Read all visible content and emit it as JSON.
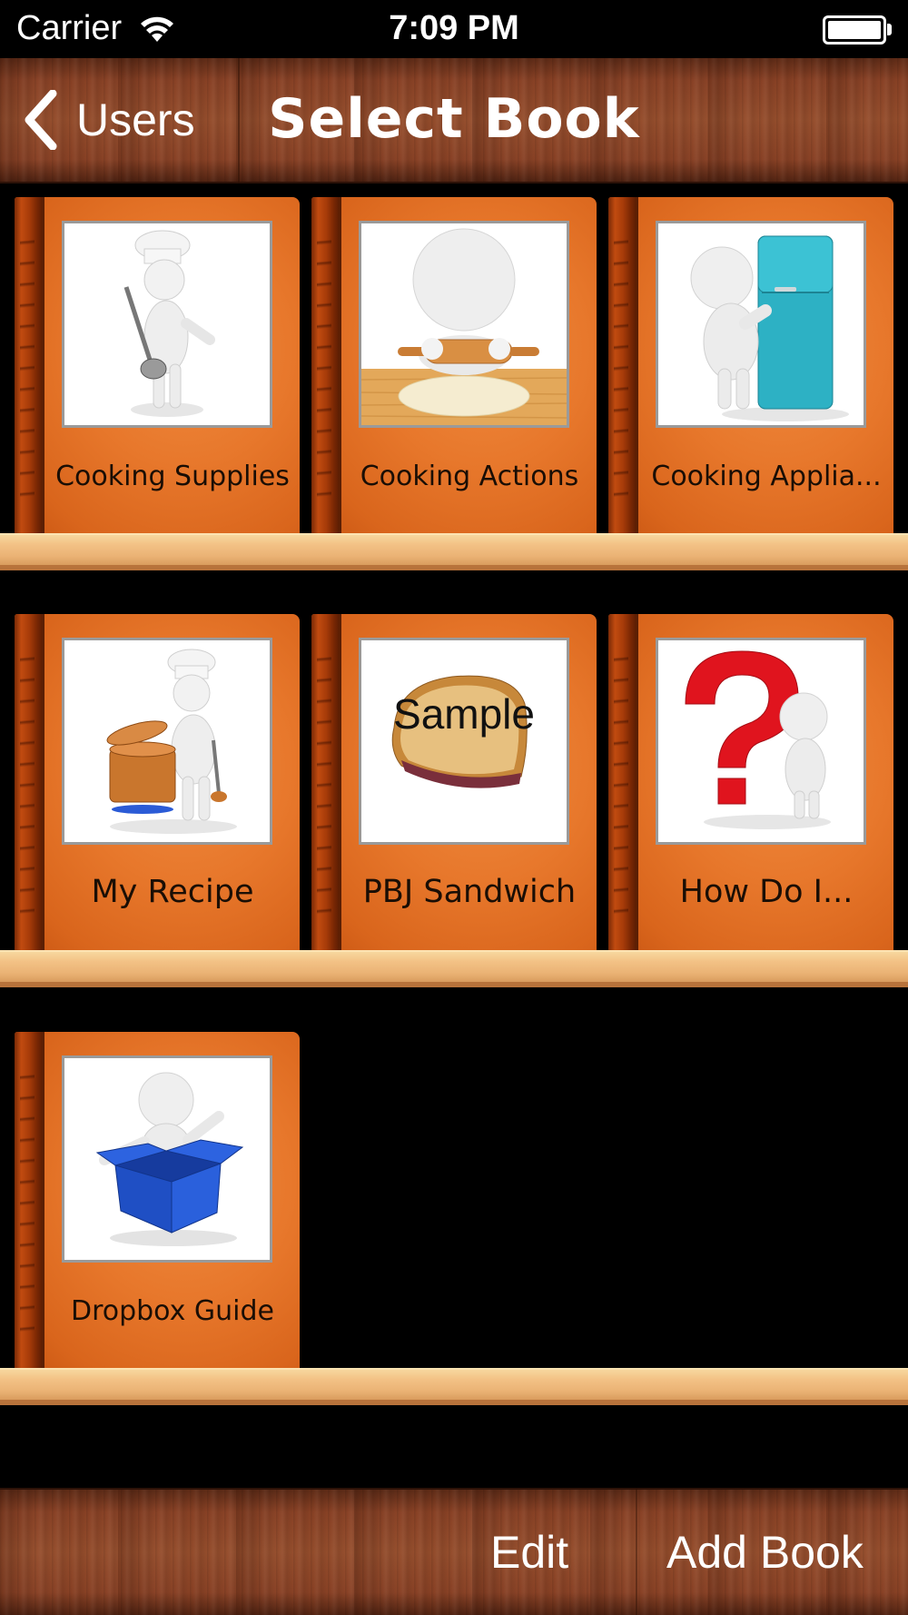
{
  "status_bar": {
    "carrier": "Carrier",
    "time": "7:09 PM",
    "wifi_icon": "wifi-icon",
    "battery_icon": "battery-icon"
  },
  "nav": {
    "back_label": "Users",
    "back_icon": "chevron-left-icon",
    "title": "Select Book"
  },
  "books": [
    {
      "title": "Cooking Supplies",
      "icon": "chef-with-ladle-illustration"
    },
    {
      "title": "Cooking Actions",
      "icon": "rolling-pin-illustration"
    },
    {
      "title": "Cooking Applia...",
      "icon": "refrigerator-illustration"
    },
    {
      "title": "My Recipe",
      "icon": "chef-with-pot-illustration"
    },
    {
      "title": "PBJ Sandwich",
      "icon": "sandwich-illustration",
      "overlay": "Sample"
    },
    {
      "title": "How Do I...",
      "icon": "question-mark-illustration"
    },
    {
      "title": "Dropbox Guide",
      "icon": "dropbox-box-illustration"
    }
  ],
  "toolbar": {
    "edit_label": "Edit",
    "add_book_label": "Add Book"
  },
  "colors": {
    "book_orange": "#e7772b",
    "shelf": "#f3c286",
    "wood": "#8a4327",
    "fridge": "#2db1c4",
    "question_red": "#e0141e",
    "box_blue": "#1f4fc4"
  }
}
